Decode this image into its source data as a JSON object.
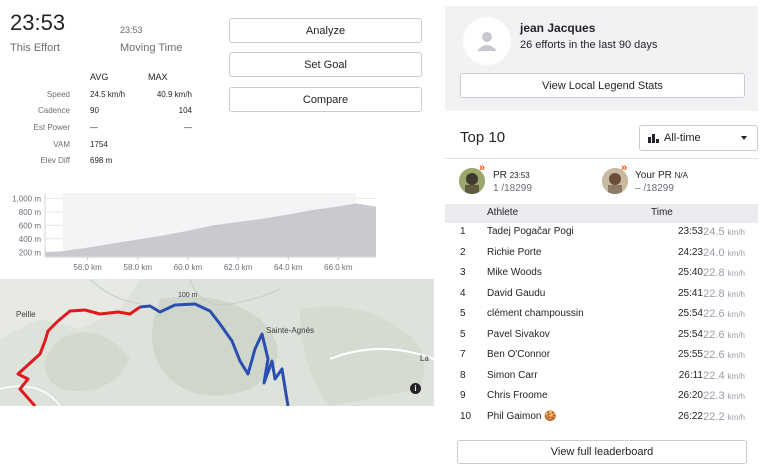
{
  "effort": {
    "time": "23:53",
    "time_label": "This Effort",
    "moving_time": "23:53",
    "moving_label": "Moving Time"
  },
  "actions": {
    "analyze": "Analyze",
    "set_goal": "Set Goal",
    "compare": "Compare"
  },
  "stats": {
    "avg_header": "AVG",
    "max_header": "MAX",
    "rows": [
      {
        "label": "Speed",
        "avg": "24.5 km/h",
        "max": "40.9 km/h"
      },
      {
        "label": "Cadence",
        "avg": "90",
        "max": "104"
      },
      {
        "label": "Est Power",
        "avg": "—",
        "max": "—"
      },
      {
        "label": "VAM",
        "avg": "1754",
        "max": ""
      },
      {
        "label": "Elev Diff",
        "avg": "698 m",
        "max": ""
      }
    ]
  },
  "chart_data": {
    "type": "area",
    "title": "",
    "xlabel": "",
    "ylabel": "",
    "x_unit": "km",
    "y_unit": "m",
    "x_ticks": [
      "56.0 km",
      "58.0 km",
      "60.0 km",
      "62.0 km",
      "64.0 km",
      "66.0 km"
    ],
    "y_ticks": [
      "1,000 m",
      "800 m",
      "600 m",
      "400 m",
      "200 m"
    ],
    "xlim": [
      54.3,
      67.5
    ],
    "ylim": [
      130,
      1080
    ],
    "highlight_range": [
      55.0,
      66.7
    ],
    "x": [
      54.3,
      55.0,
      56.0,
      57.0,
      58.0,
      59.0,
      60.0,
      61.0,
      62.0,
      63.0,
      64.0,
      65.0,
      66.0,
      66.7,
      67.5
    ],
    "y": [
      200,
      215,
      270,
      330,
      390,
      450,
      520,
      600,
      650,
      700,
      760,
      830,
      880,
      925,
      880
    ],
    "fill_color": "#c9c9cf",
    "grid": true
  },
  "map": {
    "labels": [
      "Peille",
      "Sainte-Agnès",
      "100 m",
      "La"
    ],
    "route_colors": {
      "red": "#e0191e",
      "blue": "#2b4fb0"
    }
  },
  "local_legend": {
    "name": "jean Jacques",
    "subtitle": "26 efforts in the last 90 days",
    "button": "View Local Legend Stats"
  },
  "leaderboard": {
    "title": "Top 10",
    "filter": "All-time",
    "pr": {
      "label": "PR",
      "time": "23:53",
      "rank": "1",
      "total": "/18299"
    },
    "your_pr": {
      "label": "Your PR",
      "value": "N/A",
      "rank": "–",
      "total": "/18299"
    },
    "header_athlete": "Athlete",
    "header_time": "Time",
    "speed_unit": "km/h",
    "rows": [
      {
        "rank": "1",
        "name": "Tadej Pogačar Pogi",
        "time": "23:53",
        "speed": "24.5"
      },
      {
        "rank": "2",
        "name": "Richie Porte",
        "time": "24:23",
        "speed": "24.0"
      },
      {
        "rank": "3",
        "name": "Mike Woods",
        "time": "25:40",
        "speed": "22.8"
      },
      {
        "rank": "4",
        "name": "David Gaudu",
        "time": "25:41",
        "speed": "22.8"
      },
      {
        "rank": "5",
        "name": "clément champoussin",
        "time": "25:54",
        "speed": "22.6"
      },
      {
        "rank": "5",
        "name": "Pavel Sivakov",
        "time": "25:54",
        "speed": "22.6"
      },
      {
        "rank": "7",
        "name": "Ben O'Connor",
        "time": "25:55",
        "speed": "22.6"
      },
      {
        "rank": "8",
        "name": "Simon Carr",
        "time": "26:11",
        "speed": "22.4"
      },
      {
        "rank": "9",
        "name": "Chris Froome",
        "time": "26:20",
        "speed": "22.3"
      },
      {
        "rank": "10",
        "name": "Phil Gaimon 🍪",
        "time": "26:22",
        "speed": "22.2"
      }
    ],
    "full_button": "View full leaderboard"
  },
  "colors": {
    "accent": "#fc4c02",
    "text": "#242428",
    "muted": "#6d6d78",
    "panel": "#f2f2f4"
  }
}
